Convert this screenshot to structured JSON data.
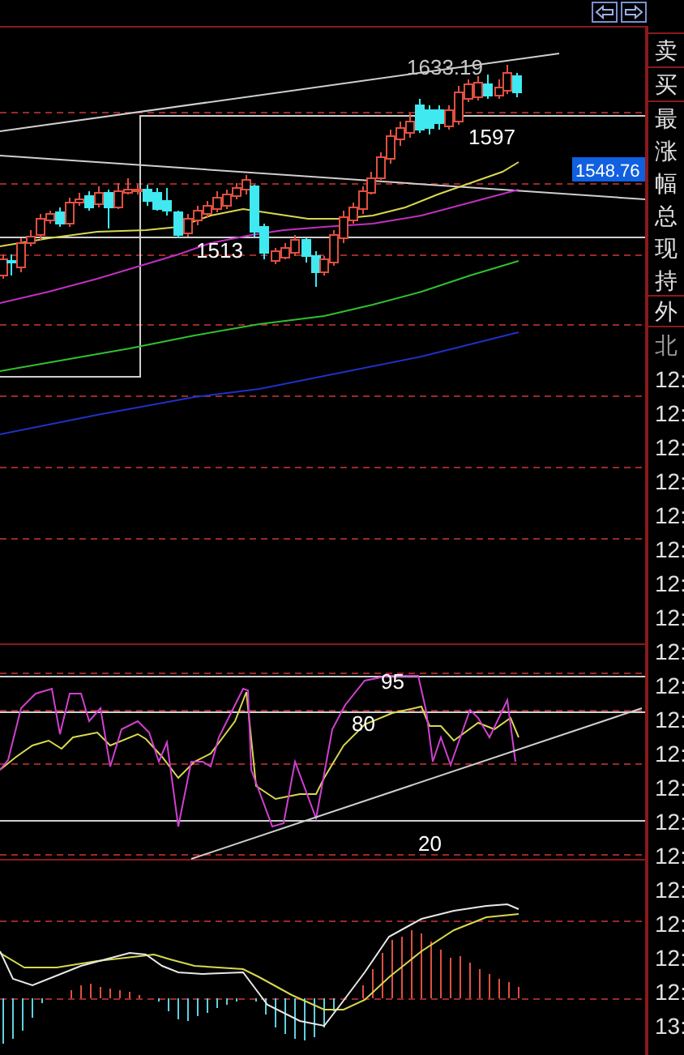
{
  "price_chart": {
    "high_label": "1633.19",
    "swing_label": "1597",
    "low_label": "1513",
    "current_price": "1548.76"
  },
  "oscillator": {
    "level_labels": [
      "95",
      "80",
      "20"
    ]
  },
  "quote_panel": {
    "order_book": [
      "卖",
      "买"
    ],
    "stats": [
      "最",
      "涨",
      "幅",
      "总",
      "现",
      "持"
    ],
    "outer": "外",
    "north": "北",
    "times": [
      "12:",
      "12:",
      "12:",
      "12:",
      "12:",
      "12:",
      "12:",
      "12:",
      "12:",
      "12:",
      "12:",
      "12:",
      "12:",
      "12:",
      "12:",
      "12:",
      "12:",
      "12:",
      "12:",
      "13:"
    ]
  }
}
